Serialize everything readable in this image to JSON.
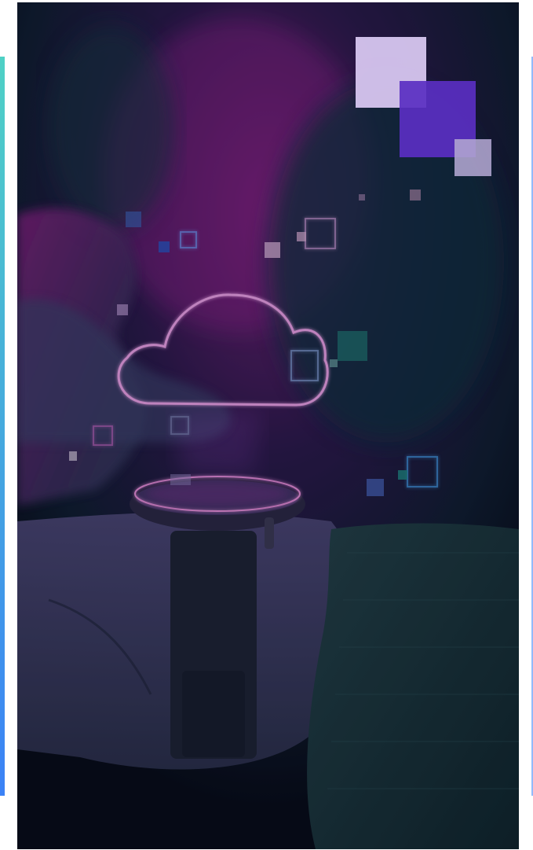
{
  "hero": {
    "image": "cloud-computing-smartwatch-photo",
    "colors": {
      "background": "#0c0f1f",
      "magenta": "#8b1f8a",
      "teal": "#1f6b77",
      "purple_accent": "#5a2fc2",
      "lavender_accent": "#d7c6f0"
    }
  },
  "decorations": {
    "squares": [
      "lavender-square",
      "purple-square",
      "grey-square"
    ]
  }
}
